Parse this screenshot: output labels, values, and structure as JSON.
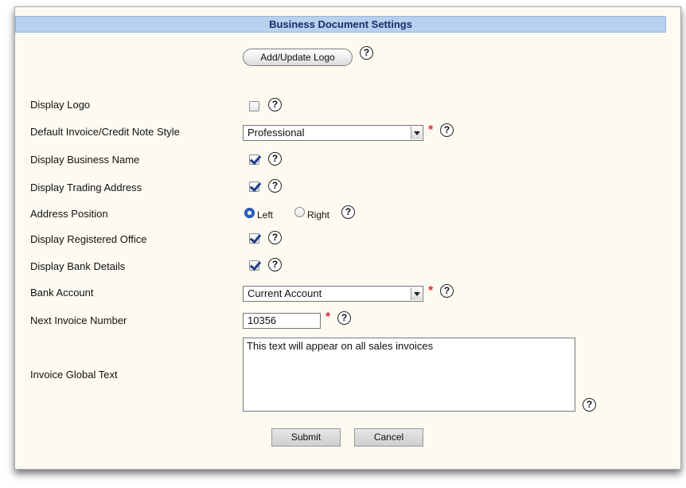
{
  "header": {
    "title": "Business Document Settings"
  },
  "logo": {
    "button_label": "Add/Update Logo"
  },
  "help_glyph": "?",
  "required_glyph": "*",
  "fields": {
    "display_logo": {
      "label": "Display Logo",
      "checked": false
    },
    "invoice_style": {
      "label": "Default Invoice/Credit Note Style",
      "value": "Professional"
    },
    "display_business_name": {
      "label": "Display Business Name",
      "checked": true
    },
    "display_trading_address": {
      "label": "Display Trading Address",
      "checked": true
    },
    "address_position": {
      "label": "Address Position",
      "options": [
        "Left",
        "Right"
      ],
      "selected": "Left"
    },
    "display_registered_office": {
      "label": "Display Registered Office",
      "checked": true
    },
    "display_bank_details": {
      "label": "Display Bank Details",
      "checked": true
    },
    "bank_account": {
      "label": "Bank Account",
      "value": "Current Account"
    },
    "next_invoice_number": {
      "label": "Next Invoice Number",
      "value": "10356"
    },
    "invoice_global_text": {
      "label": "Invoice Global Text",
      "value": "This text will appear on all sales invoices"
    }
  },
  "actions": {
    "submit_label": "Submit",
    "cancel_label": "Cancel"
  }
}
